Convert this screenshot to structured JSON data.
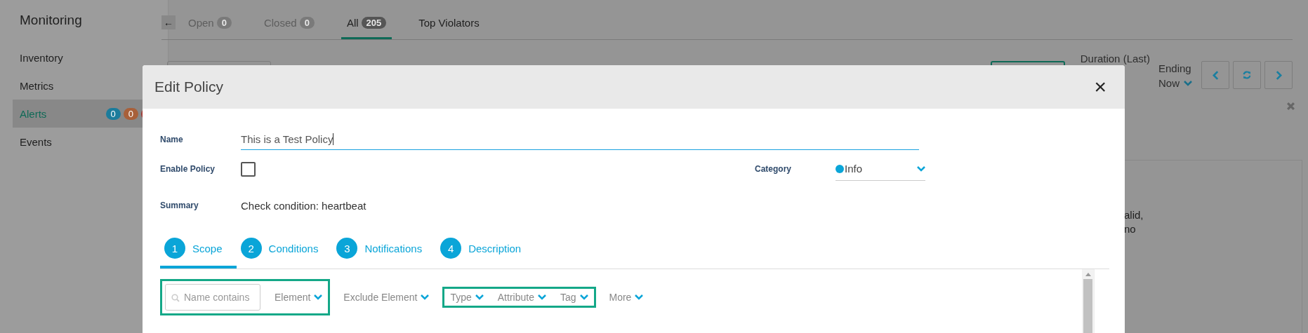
{
  "sidebar": {
    "title": "Monitoring",
    "items": [
      {
        "label": "Inventory",
        "selected": false
      },
      {
        "label": "Metrics",
        "selected": false
      },
      {
        "label": "Alerts",
        "selected": true,
        "badges": [
          {
            "text": "0",
            "color": "#1b7c9c"
          },
          {
            "text": "0",
            "color": "#a8603a"
          },
          {
            "color": "#a33a33"
          }
        ]
      },
      {
        "label": "Events",
        "selected": false
      }
    ]
  },
  "back_button": "←",
  "tabs": [
    {
      "label": "Open",
      "count": "0",
      "selected": false
    },
    {
      "label": "Closed",
      "count": "0",
      "selected": false
    },
    {
      "label": "All",
      "count": "205",
      "selected": true
    },
    {
      "label": "Top Violators",
      "selected": false
    }
  ],
  "toolbar": {
    "duration_label": "Duration (Last)",
    "ending_label": "Ending",
    "ending_value": "Now"
  },
  "background_text": [
    "alid,",
    "no"
  ],
  "modal": {
    "title": "Edit Policy",
    "close": "×",
    "name": {
      "label": "Name",
      "value": "This is a Test Policy"
    },
    "enable": {
      "label": "Enable Policy",
      "checked": false
    },
    "category": {
      "label": "Category",
      "value": "Info",
      "color": "#0aa5d8"
    },
    "summary": {
      "label": "Summary",
      "value": "Check condition: heartbeat"
    },
    "steps": [
      {
        "number": "1",
        "label": "Scope",
        "selected": true
      },
      {
        "number": "2",
        "label": "Conditions",
        "selected": false
      },
      {
        "number": "3",
        "label": "Notifications",
        "selected": false
      },
      {
        "number": "4",
        "label": "Description",
        "selected": false
      }
    ],
    "filter_groups": [
      {
        "highlighted": true,
        "items": [
          {
            "kind": "search",
            "placeholder": "Name contains"
          },
          {
            "kind": "dropdown",
            "label": "Element"
          }
        ]
      },
      {
        "highlighted": false,
        "items": [
          {
            "kind": "dropdown",
            "label": "Exclude Element"
          }
        ]
      },
      {
        "highlighted": true,
        "items": [
          {
            "kind": "dropdown",
            "label": "Type"
          },
          {
            "kind": "dropdown",
            "label": "Attribute"
          },
          {
            "kind": "dropdown",
            "label": "Tag"
          }
        ]
      },
      {
        "highlighted": false,
        "items": [
          {
            "kind": "dropdown",
            "label": "More"
          }
        ]
      }
    ]
  }
}
